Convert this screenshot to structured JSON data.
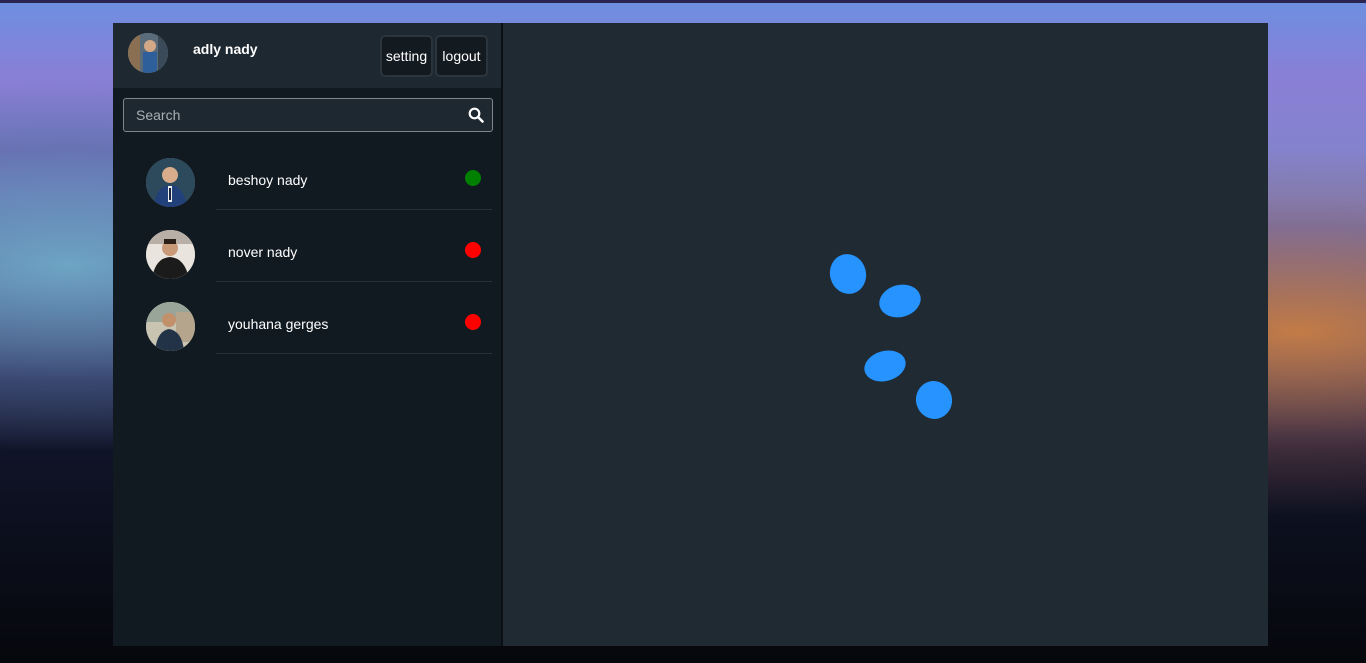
{
  "user": {
    "name": "adly nady",
    "avatar_icon": "user-avatar"
  },
  "header": {
    "setting_label": "setting",
    "logout_label": "logout"
  },
  "search": {
    "placeholder": "Search",
    "icon": "search-icon"
  },
  "contacts": [
    {
      "name": "beshoy nady",
      "status": "online",
      "status_color": "#008000"
    },
    {
      "name": "nover nady",
      "status": "offline",
      "status_color": "#ff0000"
    },
    {
      "name": "youhana gerges",
      "status": "offline",
      "status_color": "#ff0000"
    }
  ],
  "loader": {
    "color": "#2693ff",
    "icon": "loading-spinner"
  }
}
